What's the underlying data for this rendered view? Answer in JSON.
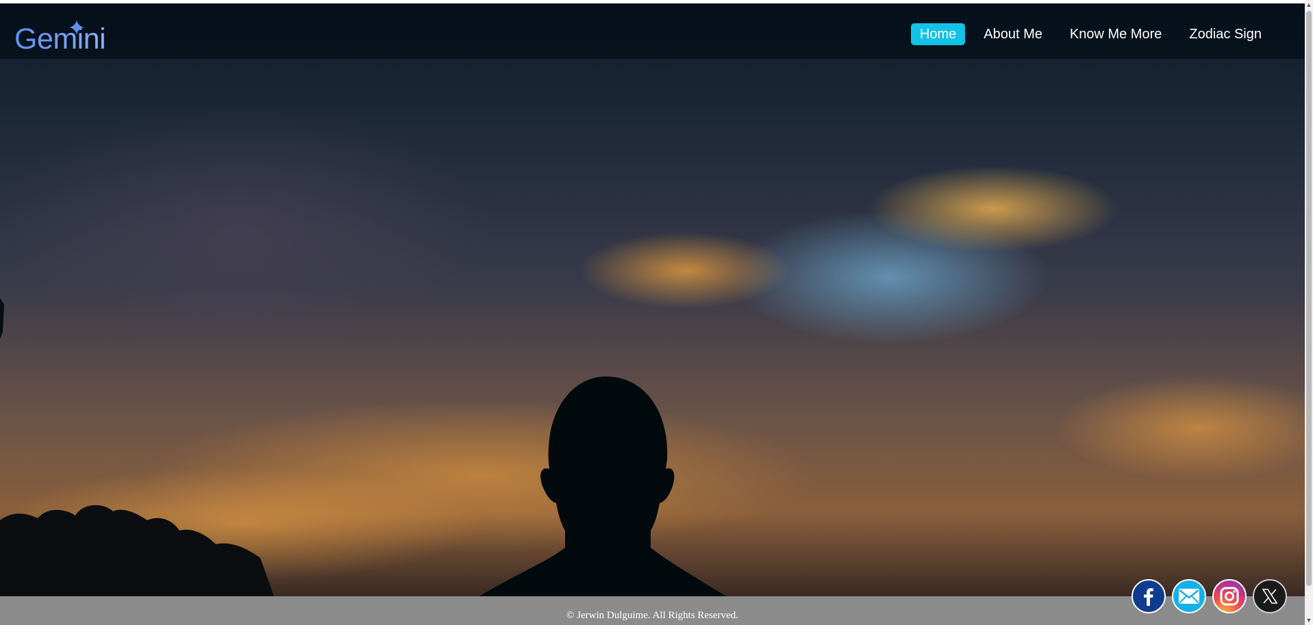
{
  "brand": {
    "logo_text": "Gemini",
    "logo_icon": "sparkle-icon",
    "logo_color": "#6f9cf2"
  },
  "nav": {
    "items": [
      {
        "label": "Home",
        "active": true
      },
      {
        "label": "About Me",
        "active": false
      },
      {
        "label": "Know Me More",
        "active": false
      },
      {
        "label": "Zodiac Sign",
        "active": false
      }
    ],
    "active_color": "#13c2e6"
  },
  "hero": {
    "image": "sunset-sky-silhouette"
  },
  "footer": {
    "copyright": "© Jerwin Dulguime. All Rights Reserved."
  },
  "socials": [
    {
      "name": "facebook",
      "icon": "facebook-icon",
      "color": "#0f3c8f"
    },
    {
      "name": "email",
      "icon": "mail-icon",
      "color": "#16b0e8"
    },
    {
      "name": "instagram",
      "icon": "instagram-icon",
      "color": "#c13584"
    },
    {
      "name": "x",
      "icon": "x-icon",
      "color": "#1a1a1a"
    }
  ]
}
